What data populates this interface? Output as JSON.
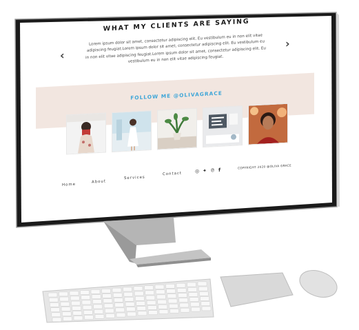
{
  "testimonials": {
    "heading": "WHAT MY CLIENTS ARE SAYING",
    "quote_lines": [
      "Lorem ipsum dolor sit amet, consectetur adipiscing elit. Eu vestibulum eu in non elit vitae",
      "adipiscing feugiat.Lorem ipsum dolor sit amet, consectetur adipiscing elit. Eu vestibulum eu",
      "in non elit vitae adipiscing feugiat.Lorem ipsum dolor sit amet, consectetur adipiscing elit. Eu",
      "vestibulum eu in non elit vitae adipiscing feugiat."
    ],
    "prev_icon": "chevron-left-icon",
    "next_icon": "chevron-right-icon"
  },
  "instagram": {
    "title": "FOLLOW ME @OLIVAGRACE",
    "band_color": "#f2e6e0",
    "title_color": "#3fa6d8",
    "photos": [
      "woman-with-camera-photo",
      "woman-in-white-dress-photo",
      "potted-plant-photo",
      "desk-flatlay-photo",
      "woman-portrait-photo"
    ]
  },
  "footer": {
    "nav": [
      "Home",
      "About",
      "Services",
      "Contact"
    ],
    "social_icons": [
      "instagram-icon",
      "twitter-icon",
      "pinterest-icon",
      "facebook-icon"
    ],
    "copyright": "COPYRIGHT 2020 @OLIVA GRACE"
  }
}
